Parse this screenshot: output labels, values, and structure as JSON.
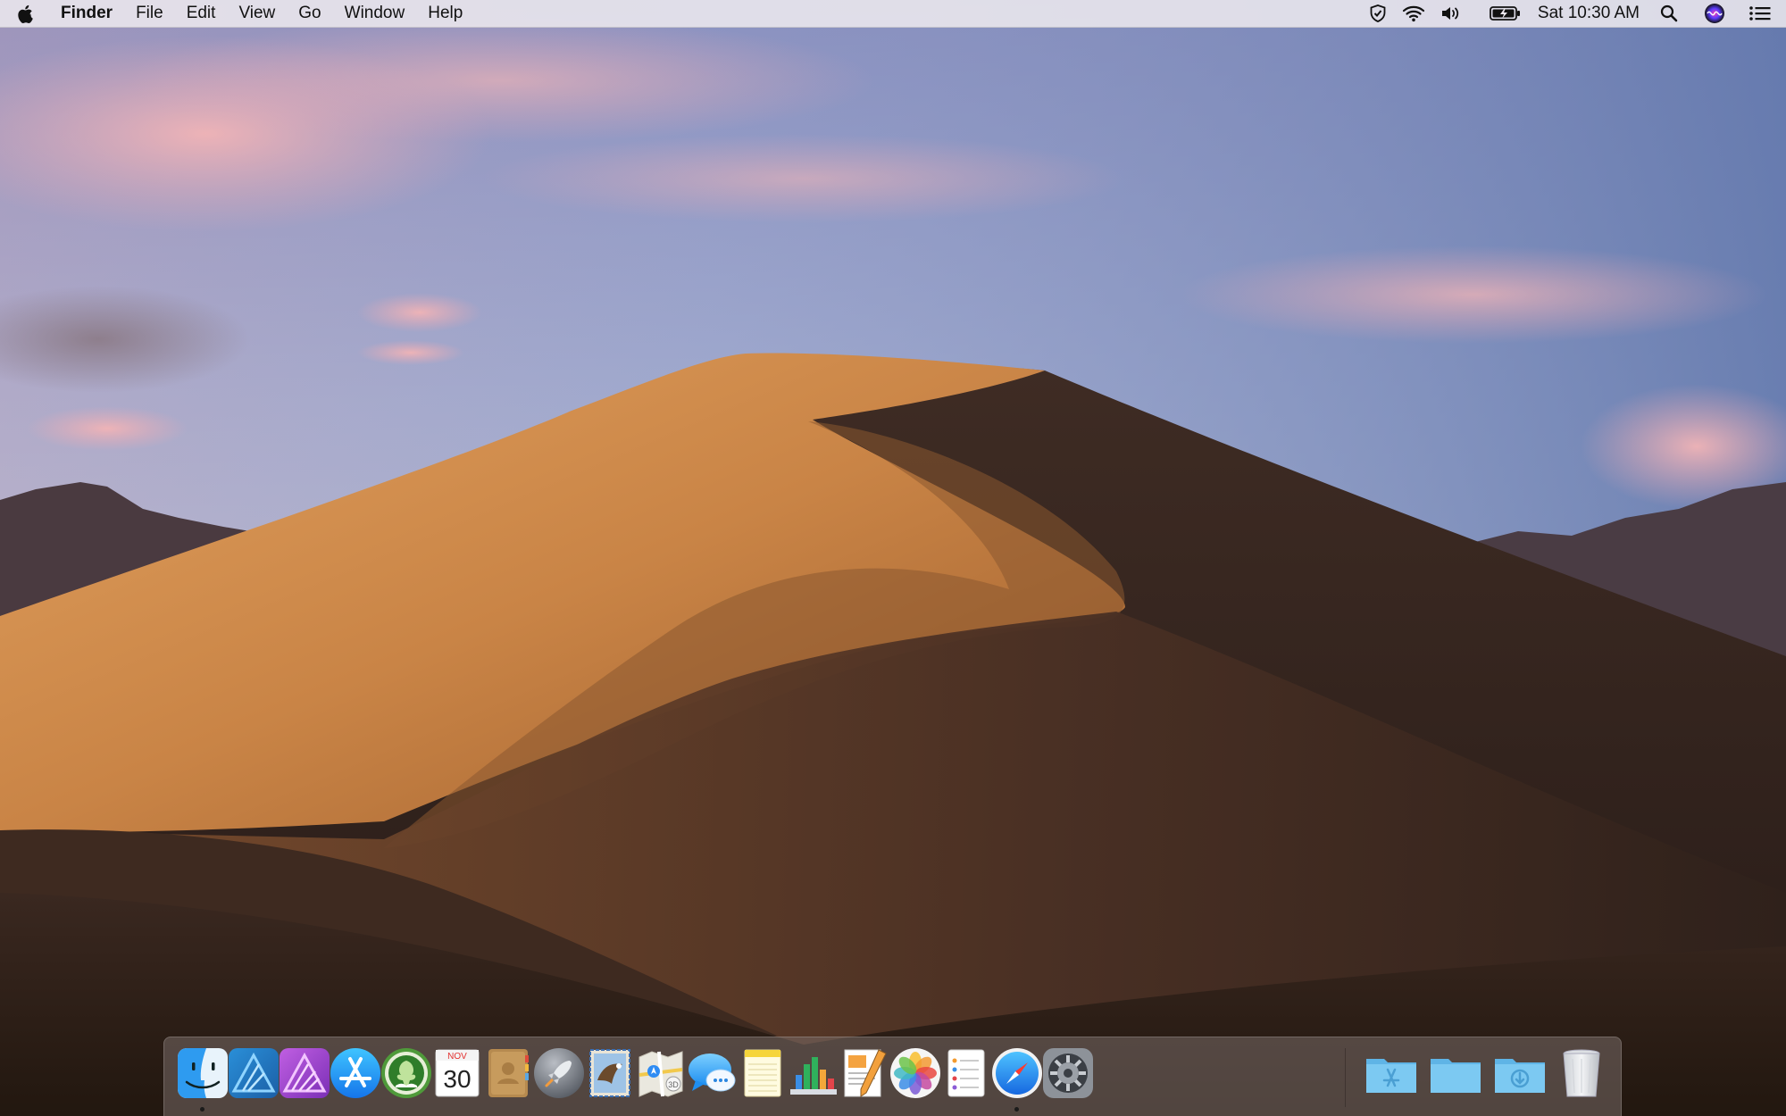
{
  "menubar": {
    "apple_icon": "apple-icon",
    "app_name": "Finder",
    "menus": [
      "File",
      "Edit",
      "View",
      "Go",
      "Window",
      "Help"
    ],
    "status_icons": [
      "shield-check-icon",
      "wifi-icon",
      "volume-icon",
      "battery-charging-icon"
    ],
    "clock": "Sat 10:30 AM",
    "right_icons": [
      "spotlight-search-icon",
      "siri-icon",
      "notification-center-icon"
    ]
  },
  "calendar_icon": {
    "month": "NOV",
    "day": "30"
  },
  "dock": {
    "apps": [
      {
        "name": "Finder",
        "icon": "finder-icon",
        "running": true
      },
      {
        "name": "Affinity Designer",
        "icon": "affinity-designer-icon",
        "running": false
      },
      {
        "name": "Affinity Photo",
        "icon": "affinity-photo-icon",
        "running": false
      },
      {
        "name": "App Store",
        "icon": "app-store-icon",
        "running": false
      },
      {
        "name": "Dictionary",
        "icon": "dictionary-icon",
        "running": false
      },
      {
        "name": "Calendar",
        "icon": "calendar-icon",
        "running": false
      },
      {
        "name": "Contacts",
        "icon": "contacts-icon",
        "running": false
      },
      {
        "name": "Launchpad",
        "icon": "launchpad-icon",
        "running": false
      },
      {
        "name": "Mail",
        "icon": "mail-icon",
        "running": false
      },
      {
        "name": "Maps",
        "icon": "maps-icon",
        "running": false
      },
      {
        "name": "Messages",
        "icon": "messages-icon",
        "running": false
      },
      {
        "name": "Notes",
        "icon": "notes-icon",
        "running": false
      },
      {
        "name": "Numbers",
        "icon": "numbers-icon",
        "running": false
      },
      {
        "name": "Pages",
        "icon": "pages-icon",
        "running": false
      },
      {
        "name": "Photos",
        "icon": "photos-icon",
        "running": false
      },
      {
        "name": "Reminders",
        "icon": "reminders-icon",
        "running": false
      },
      {
        "name": "Safari",
        "icon": "safari-icon",
        "running": true
      },
      {
        "name": "System Preferences",
        "icon": "system-preferences-icon",
        "running": false
      }
    ],
    "folders": [
      {
        "name": "Applications",
        "icon": "applications-folder-icon"
      },
      {
        "name": "Documents",
        "icon": "documents-folder-icon"
      },
      {
        "name": "Downloads",
        "icon": "downloads-folder-icon"
      },
      {
        "name": "Trash",
        "icon": "trash-icon"
      }
    ]
  },
  "colors": {
    "menubar": "#ece8ee",
    "sky_top": "#6f83b4",
    "dune_light": "#d89a58",
    "dune_shadow": "#2c1f1a",
    "folder_blue": "#6ec2ee",
    "dock": "#786c68"
  }
}
